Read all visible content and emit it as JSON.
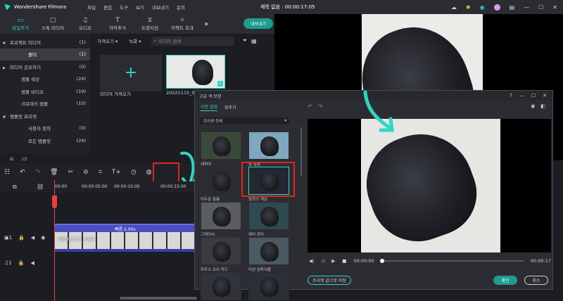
{
  "app": {
    "title": "Wondershare Filmora",
    "project_title": "제목 없음 : 00:00:17:05"
  },
  "menu": [
    "파일",
    "편집",
    "도구",
    "보기",
    "내보내기",
    "문의"
  ],
  "tabs": [
    {
      "label": "파일추가",
      "icon": "folder-icon"
    },
    {
      "label": "스톡 미디어",
      "icon": "stock-icon"
    },
    {
      "label": "오디오",
      "icon": "music-icon"
    },
    {
      "label": "자막추가",
      "icon": "text-icon"
    },
    {
      "label": "트랜지션",
      "icon": "transition-icon"
    },
    {
      "label": "이펙트 효과",
      "icon": "effect-icon"
    }
  ],
  "export_label": "내보내기",
  "sidebar": [
    {
      "label": "프로젝트 미디어",
      "count": "(1)",
      "arrow": "▼"
    },
    {
      "label": "폴더",
      "count": "(1)",
      "arrow": ""
    },
    {
      "label": "미디어 공유하기",
      "count": "(0)",
      "arrow": "▶"
    },
    {
      "label": "샘플 색상",
      "count": "(24)",
      "arrow": ""
    },
    {
      "label": "샘플 비디오",
      "count": "(19)",
      "arrow": ""
    },
    {
      "label": "크로마키 샘플",
      "count": "(10)",
      "arrow": ""
    },
    {
      "label": "템플릿 프리셋",
      "count": "",
      "arrow": "▼"
    },
    {
      "label": "사용자 정의",
      "count": "(0)",
      "arrow": ""
    },
    {
      "label": "모든 템플릿",
      "count": "(24)",
      "arrow": ""
    }
  ],
  "media": {
    "import_label": "가져오기",
    "record_label": "녹화",
    "search_placeholder": "미디어 검색",
    "import_media_label": "미디어 가져오기",
    "clip_name": "20221115_0"
  },
  "timeline": {
    "ticks": [
      "00:00",
      "00:00:05:00",
      "00:00:10:00",
      "00:00:15:00"
    ],
    "speed_label": "빠름 2.00x",
    "clip_label": "20221115_1526"
  },
  "dialog": {
    "title": "고급 색 보정",
    "tab_preset": "사전 설정",
    "tab_adjust": "맞추기",
    "filter_select": "프리셋 전체",
    "presets": [
      "세피아",
      "쿨 필름",
      "어두운 필름",
      "범죄의 게임",
      "그레이씨",
      "헤리 포터",
      "하우스 오브 카드",
      "미션 임파서블",
      "",
      ""
    ],
    "time_start": "00:00:00",
    "time_end": "00:00:17",
    "save_preset_label": "프리셋 값으로 저장",
    "ok_label": "확인",
    "cancel_label": "취소"
  }
}
